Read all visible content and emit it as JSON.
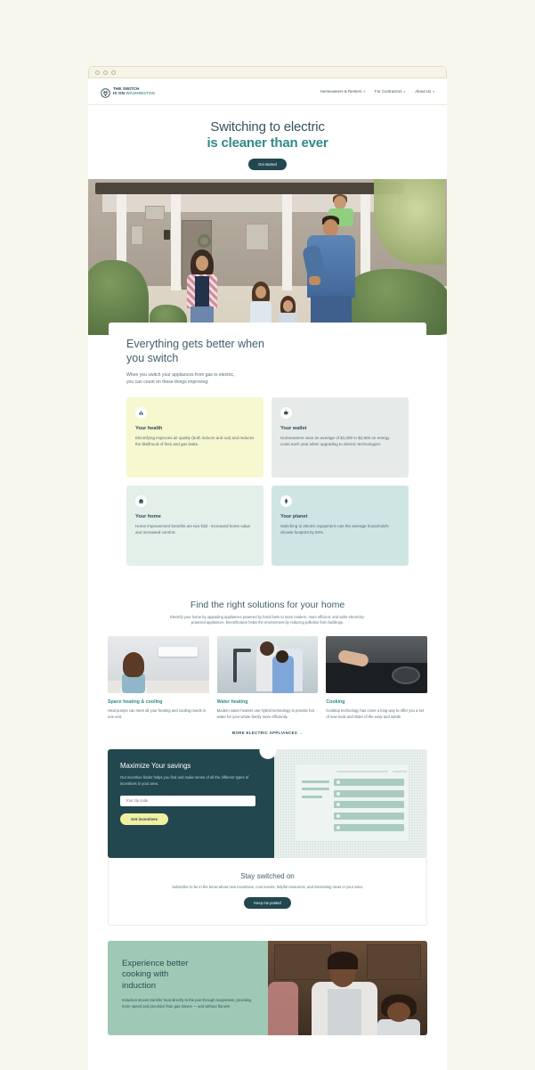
{
  "browser": {
    "dots": 3
  },
  "header": {
    "logo": {
      "line1": "THE SWITCH",
      "line2_a": "IS ON ",
      "line2_b": "WASHINGTON",
      "icon": "plug-circle-icon"
    },
    "nav": [
      {
        "label": "Homeowners & Renters",
        "caret": "▾"
      },
      {
        "label": "For Contractors",
        "caret": "▾"
      },
      {
        "label": "About Us",
        "caret": "▾"
      }
    ]
  },
  "hero": {
    "title_line1": "Switching to electric",
    "title_line2": "is cleaner than ever",
    "cta": "Get started"
  },
  "benefits": {
    "title_line1": "Everything gets better when",
    "title_line2": "you switch",
    "sub_line1": "When you switch your appliances from gas to electric,",
    "sub_line2": "you can count on these things improving:",
    "cards": [
      {
        "icon": "lungs-icon",
        "title": "Your health",
        "text": "Electrifying improves air quality (both indoors and out) and reduces the likelihood of fires and gas leaks."
      },
      {
        "icon": "piggy-bank-icon",
        "title": "Your wallet",
        "text": "Homeowners save an average of $1,000 to $2,800 on energy costs each year when upgrading to electric technologies."
      },
      {
        "icon": "home-icon",
        "title": "Your home",
        "text": "Home improvement benefits are two-fold - increased home value and increased comfort."
      },
      {
        "icon": "tree-icon",
        "title": "Your planet",
        "text": "Switching to electric equipment cuts the average household's climate footprint by 50%."
      }
    ]
  },
  "solutions": {
    "title": "Find the right solutions for your home",
    "sub": "Electrify your home by upgrading appliances powered by fossil fuels to more modern, more efficient, and safer electricity-powered appliances. Electrification helps the environment by reducing pollution from buildings.",
    "cards": [
      {
        "image": "mini-split-heat-pump-photo",
        "title": "Space heating & cooling",
        "text": "Heat pumps can meet all your heating and cooling needs in one unit."
      },
      {
        "image": "kitchen-faucet-family-photo",
        "title": "Water heating",
        "text": "Modern water heaters use hybrid technology to provide hot water for your whole family more efficiently."
      },
      {
        "image": "induction-cooktop-photo",
        "title": "Cooking",
        "text": "Cooktop technology has come a long way to offer you a set of new tools and slider of the easy and subtle."
      }
    ],
    "more_link": "MORE ELECTRIC APPLIANCES",
    "more_arrow": "→"
  },
  "incentives": {
    "title": "Maximize Your savings",
    "text": "Our incentive finder helps you find and make sense of all the different types of incentives in your area.",
    "zip_placeholder": "Your zip code",
    "zip_value": "",
    "cta": "Get incentives",
    "illustration": "incentive-list-mockup"
  },
  "newsletter": {
    "title": "Stay switched on",
    "text": "Subscribe to be in the know about new incentives, cool events, helpful resources, and interesting news in your area.",
    "cta": "Keep me posted"
  },
  "induction": {
    "title_line1": "Experience better",
    "title_line2": "cooking with",
    "title_line3": "induction",
    "text": "Induction stoves transfer heat directly to the pan through magnetism, providing more speed and precision than gas stoves — and without flames!",
    "image": "father-and-child-cooking-photo"
  },
  "colors": {
    "page_bg": "#f7f7ee",
    "teal_dark": "#22474f",
    "teal_accent": "#2f8b88",
    "heading": "#41606b",
    "yellow": "#f2f0a0",
    "card_yellow": "#f7f7d0",
    "card_grey": "#e6ebe9",
    "card_mint": "#e3efe9",
    "card_teal": "#cfe5e3",
    "green_panel": "#9fc9b5"
  }
}
